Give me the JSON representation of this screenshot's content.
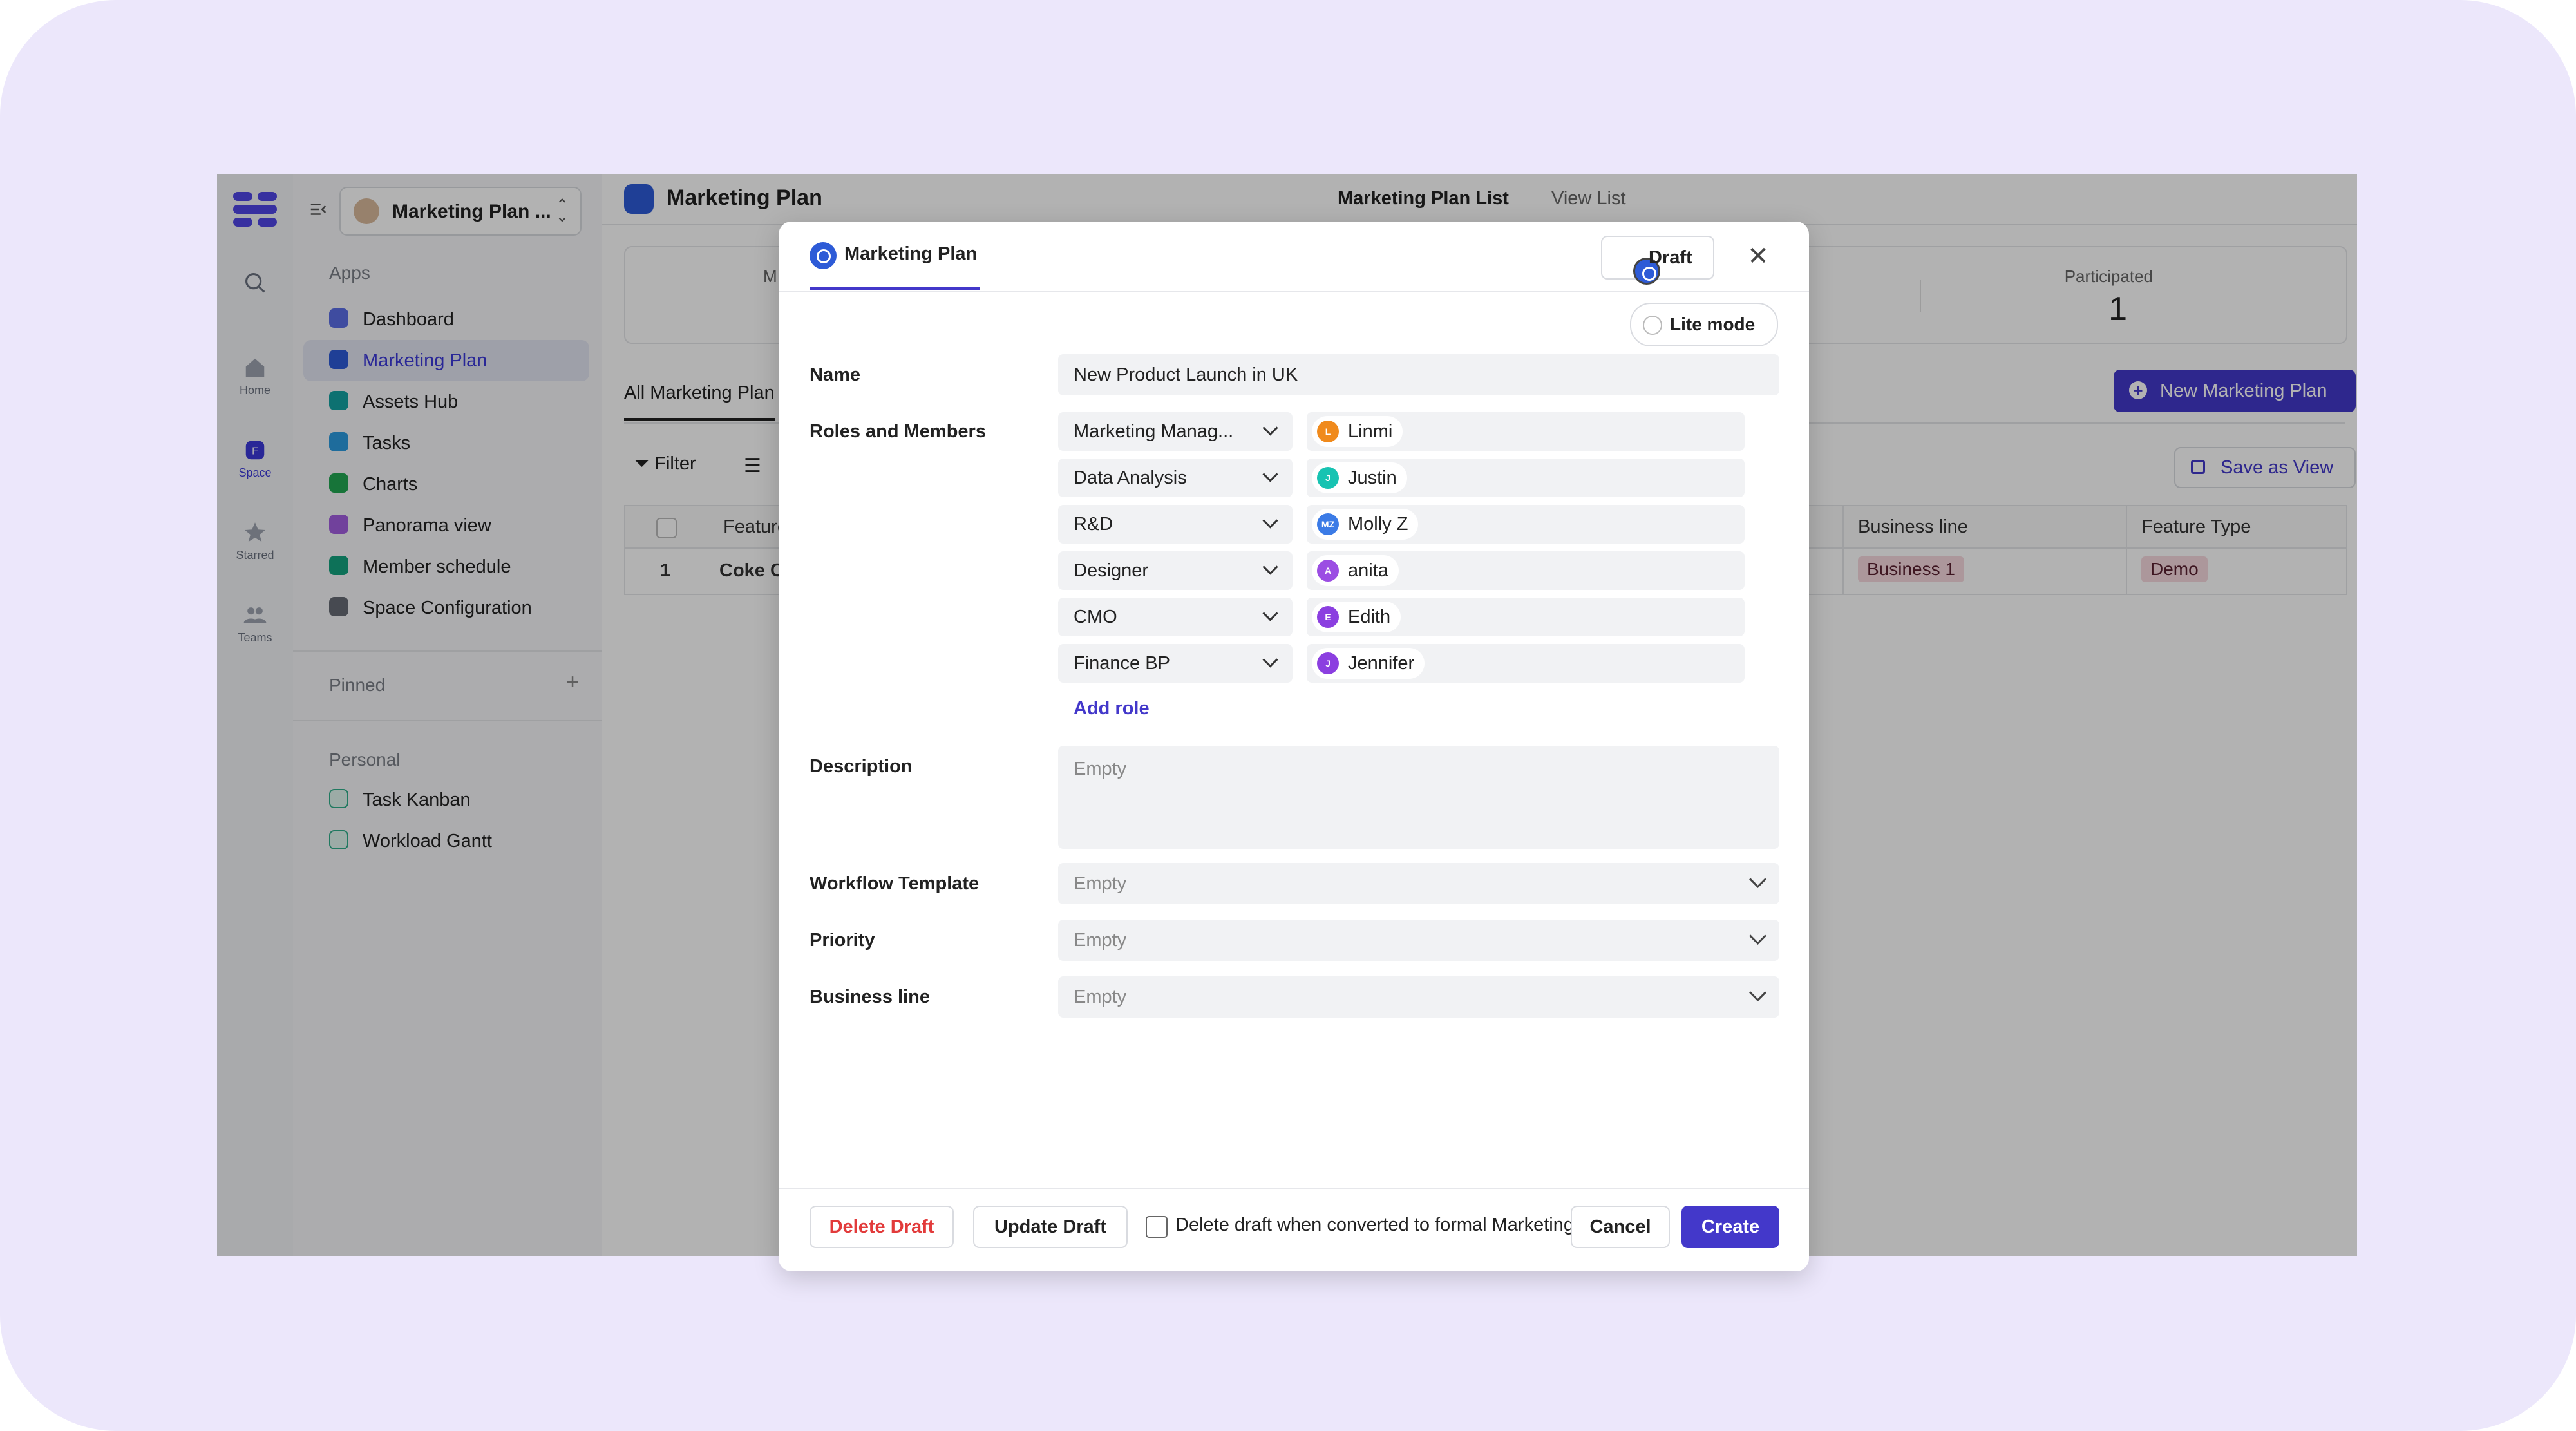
{
  "rail": {
    "items": [
      {
        "label": "",
        "icon": "search-icon"
      },
      {
        "label": "Home",
        "icon": "home-icon"
      },
      {
        "label": "Space",
        "icon": "space-icon"
      },
      {
        "label": "Starred",
        "icon": "star-icon"
      },
      {
        "label": "Teams",
        "icon": "teams-icon"
      }
    ]
  },
  "sidebar": {
    "space_name": "Marketing Plan ...",
    "apps_label": "Apps",
    "apps": [
      {
        "label": "Dashboard",
        "color": "#5b6ee6"
      },
      {
        "label": "Marketing Plan",
        "color": "#2d5bd7"
      },
      {
        "label": "Assets Hub",
        "color": "#14a3a3"
      },
      {
        "label": "Tasks",
        "color": "#2b9be0"
      },
      {
        "label": "Charts",
        "color": "#22a652"
      },
      {
        "label": "Panorama view",
        "color": "#a35ee0"
      },
      {
        "label": "Member schedule",
        "color": "#14a37f"
      },
      {
        "label": "Space Configuration",
        "color": "#666b74"
      }
    ],
    "pinned_label": "Pinned",
    "personal_label": "Personal",
    "personal": [
      {
        "label": "Task Kanban"
      },
      {
        "label": "Workload Gantt"
      }
    ]
  },
  "main": {
    "title": "Marketing Plan",
    "tabs": [
      "Marketing Plan List",
      "View List"
    ],
    "stat": {
      "label": "Participated",
      "value": "1",
      "partial_label": "M"
    },
    "view_tab": "All Marketing Plan",
    "new_button": "New Marketing Plan",
    "filter_label": "Filter",
    "save_view": "Save as View",
    "table": {
      "headers": [
        "Feature",
        "Business line",
        "Feature Type"
      ],
      "row": {
        "index": "1",
        "name": "Coke C",
        "business_line": "Business 1",
        "feature_type": "Demo"
      }
    }
  },
  "modal": {
    "title": "Marketing Plan",
    "draft_label": "Draft",
    "lite_mode": "Lite mode",
    "name_label": "Name",
    "name_value": "New Product Launch in UK",
    "roles_label": "Roles and Members",
    "roles": [
      {
        "role": "Marketing Manag...",
        "member": "Linmi",
        "initial": "L",
        "color": "#f08a1c"
      },
      {
        "role": "Data Analysis",
        "member": "Justin",
        "initial": "J",
        "color": "#17c3b2"
      },
      {
        "role": "R&D",
        "member": "Molly Z",
        "initial": "MZ",
        "color": "#3b7be6"
      },
      {
        "role": "Designer",
        "member": "anita",
        "initial": "A",
        "color": "#9b4de3"
      },
      {
        "role": "CMO",
        "member": "Edith",
        "initial": "E",
        "color": "#8b3fe0"
      },
      {
        "role": "Finance BP",
        "member": "Jennifer",
        "initial": "J",
        "color": "#8b3fe0"
      }
    ],
    "add_role": "Add role",
    "description_label": "Description",
    "description_placeholder": "Empty",
    "workflow_label": "Workflow Template",
    "workflow_value": "Empty",
    "priority_label": "Priority",
    "priority_value": "Empty",
    "business_label": "Business line",
    "business_value": "Empty",
    "footer": {
      "delete_draft": "Delete Draft",
      "update_draft": "Update Draft",
      "checkbox_label": "Delete draft when converted to formal Marketing Plan",
      "cancel": "Cancel",
      "create": "Create"
    }
  }
}
